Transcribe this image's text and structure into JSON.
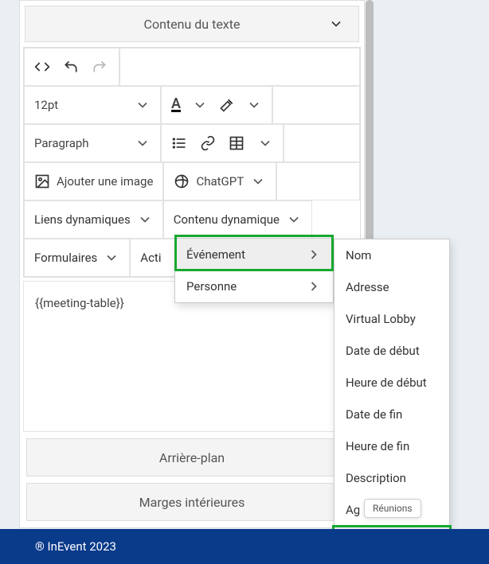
{
  "section": {
    "title": "Contenu du texte"
  },
  "toolbar": {
    "font_size": "12pt",
    "block_format": "Paragraph",
    "add_image": "Ajouter une image",
    "chatgpt": "ChatGPT",
    "dynamic_links": "Liens dynamiques",
    "dynamic_content": "Contenu dynamique",
    "forms": "Formulaires",
    "activity_truncated": "Acti"
  },
  "content": {
    "placeholder_token": "{{meeting-table}}"
  },
  "dropdown": {
    "items": [
      {
        "label": "Événement",
        "active": true
      },
      {
        "label": "Personne",
        "active": false
      }
    ]
  },
  "submenu": {
    "items": [
      "Nom",
      "Adresse",
      "Virtual Lobby",
      "Date de début",
      "Heure de début",
      "Date de fin",
      "Heure de fin",
      "Description",
      "Ag",
      "Réunions"
    ]
  },
  "tooltip": "Réunions",
  "sections": {
    "background": "Arrière-plan",
    "padding": "Marges intérieures"
  },
  "footer": "® InEvent 2023"
}
